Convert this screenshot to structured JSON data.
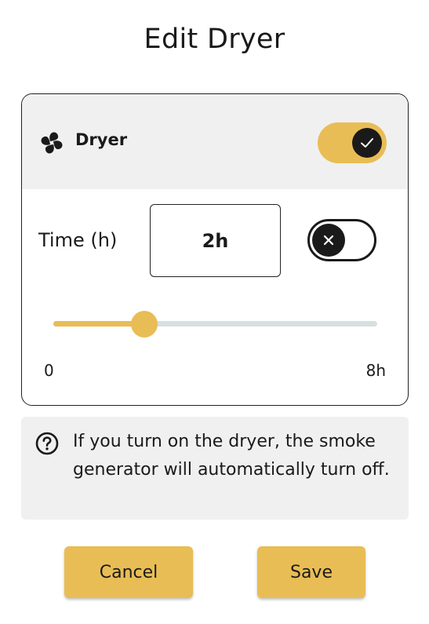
{
  "page": {
    "title": "Edit Dryer"
  },
  "dryer": {
    "label": "Dryer",
    "icon": "fan-icon",
    "enabled": true,
    "toggle_color": "#e9bd55"
  },
  "time": {
    "label": "Time (h)",
    "value": "2h",
    "timer_enabled": false
  },
  "slider": {
    "min": 0,
    "max": 8,
    "value": 2,
    "min_label": "0",
    "max_label": "8h",
    "fill_color": "#e9bd55",
    "track_color": "#d8dfe0"
  },
  "info": {
    "icon": "help-circle-icon",
    "text": "If you turn on the dryer, the smoke generator will automatically turn off."
  },
  "actions": {
    "cancel_label": "Cancel",
    "save_label": "Save"
  },
  "colors": {
    "accent": "#e9bd55",
    "panel": "#f0f0f0",
    "dark": "#1a1a1a"
  }
}
